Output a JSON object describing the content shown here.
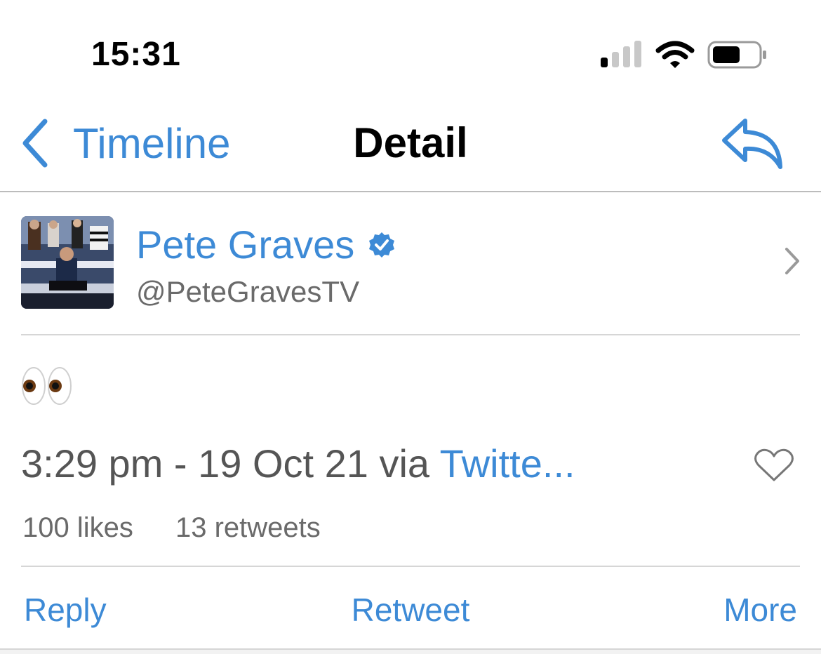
{
  "status": {
    "time": "15:31"
  },
  "nav": {
    "back_label": "Timeline",
    "title": "Detail"
  },
  "profile": {
    "name": "Pete Graves",
    "handle": "@PeteGravesTV"
  },
  "tweet": {
    "text": "👀",
    "timestamp": "3:29 pm - 19 Oct 21 via ",
    "via": "Twitte..."
  },
  "counts": {
    "likes": "100 likes",
    "retweets": "13 retweets"
  },
  "actions": {
    "reply": "Reply",
    "retweet": "Retweet",
    "more": "More"
  },
  "colors": {
    "accent": "#3d8ad6",
    "secondary_text": "#6a6a6a"
  }
}
